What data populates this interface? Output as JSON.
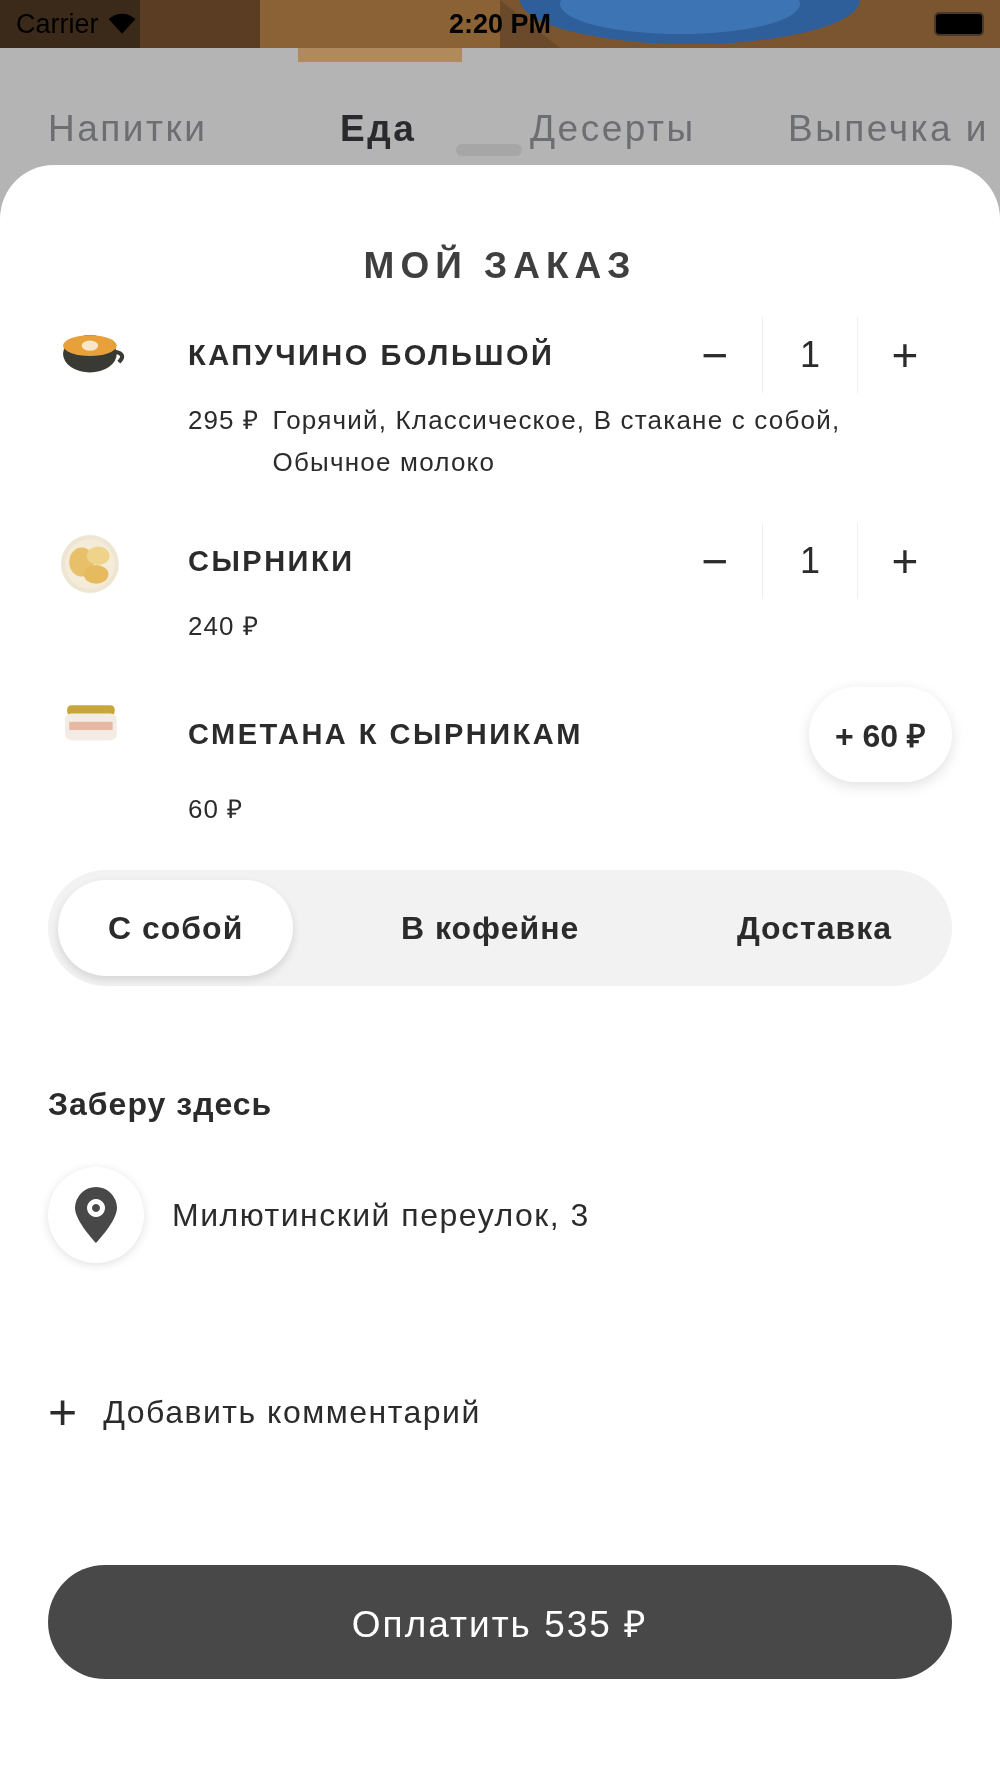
{
  "status_bar": {
    "carrier": "Carrier",
    "time": "2:20 PM"
  },
  "category_tabs": [
    {
      "label": "Напитки",
      "selected": false
    },
    {
      "label": "Еда",
      "selected": true
    },
    {
      "label": "Десерты",
      "selected": false
    },
    {
      "label": "Выпечка и",
      "selected": false
    }
  ],
  "order": {
    "title": "МОЙ ЗАКАЗ",
    "items": [
      {
        "kind": "stepper",
        "name": "КАПУЧИНО БОЛЬШОЙ",
        "price": "295 ₽",
        "options": "Горячий, Классическое, В стакане с собой, Обычное молоко",
        "minus": "−",
        "quantity": "1",
        "plus": "+"
      },
      {
        "kind": "stepper",
        "name": "СЫРНИКИ",
        "price": "240 ₽",
        "minus": "−",
        "quantity": "1",
        "plus": "+"
      },
      {
        "kind": "addon",
        "name": "СМЕТАНА К СЫРНИКАМ",
        "price": "60 ₽",
        "add_label": "+ 60 ₽"
      }
    ]
  },
  "order_type": [
    {
      "label": "С собой",
      "selected": true
    },
    {
      "label": "В кофейне",
      "selected": false
    },
    {
      "label": "Доставка",
      "selected": false
    }
  ],
  "pickup": {
    "heading": "Заберу здесь",
    "address": "Милютинский переулок, 3"
  },
  "comment": {
    "icon": "+",
    "label": "Добавить комментарий"
  },
  "pay_button": {
    "label": "Оплатить 535 ₽"
  }
}
